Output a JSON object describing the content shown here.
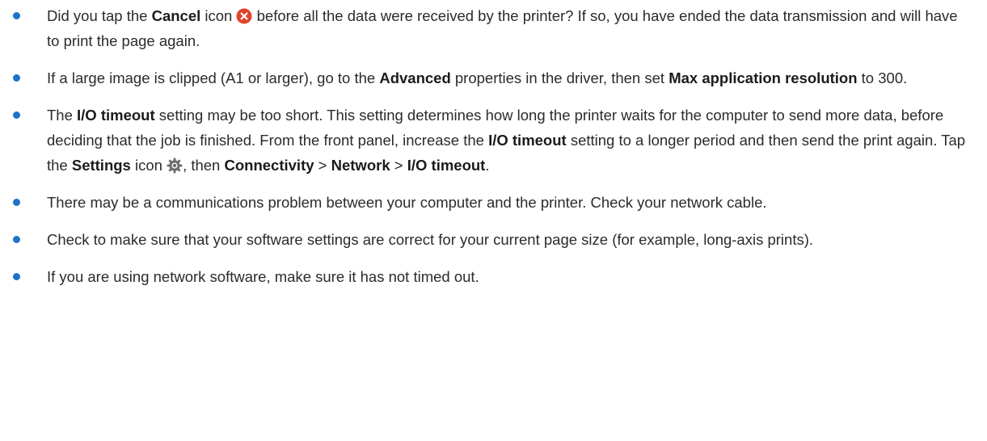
{
  "colors": {
    "bullet": "#1e73c8",
    "cancel_icon": "#e0442e",
    "settings_icon": "#6b6b6b",
    "text": "#2b2b2b"
  },
  "icons": {
    "cancel": "cancel-icon",
    "settings": "settings-icon"
  },
  "items": [
    {
      "t1": "Did you tap the ",
      "b1": "Cancel",
      "t2": "  icon ",
      "t3": " before all the data were received by the printer? If so, you have ended the data transmission and will have to print the page again."
    },
    {
      "t1": "If a large image is clipped (A1 or larger), go to the ",
      "b1": "Advanced",
      "t2": " properties in the driver, then set ",
      "b2": "Max application resolution",
      "t3": " to 300."
    },
    {
      "t1": "The ",
      "b1": "I/O timeout",
      "t2": "  setting may be too short. This setting determines how long the printer waits for the computer to send more data, before deciding that the job is finished. From the front panel, increase the ",
      "b2": "I/O timeout",
      "t3": "  setting to a longer period and then send the print again. Tap the ",
      "b3": "Settings",
      "t4": "  icon ",
      "t5": ", then ",
      "b4": "Connectivity",
      "t6": " > ",
      "b5": "Network",
      "t7": " > ",
      "b6": "I/O timeout",
      "t8": "."
    },
    {
      "t1": "There may be a communications problem between your computer and the printer. Check your network cable."
    },
    {
      "t1": "Check to make sure that your software settings are correct for your current page size (for example, long-axis prints)."
    },
    {
      "t1": "If you are using network software, make sure it has not timed out."
    }
  ]
}
